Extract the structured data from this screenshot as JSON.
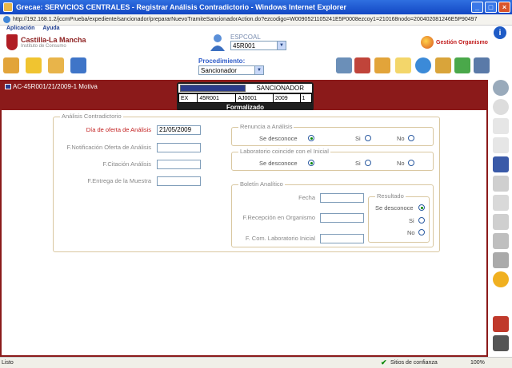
{
  "window": {
    "title": "Grecae: SERVICIOS CENTRALES - Registrar Análisis Contradictorio - Windows Internet Explorer",
    "url": "http://192.168.1.2/jccmPrueba/expediente/sancionador/prepararNuevoTramiteSancionadorAction.do?ezcodigo=W0090521105241E5P0008ezcoy1=210168nodo=200402081246E5P90497"
  },
  "menu": {
    "aplicacion": "Aplicación",
    "ayuda": "Ayuda"
  },
  "header": {
    "logo_name": "Castilla-La Mancha",
    "logo_sub": "Instituto de Consumo",
    "user_label": "ESPCOAL",
    "user_select": "45R001",
    "gestion": "Gestión Organismo",
    "procedimiento_label": "Procedimiento:",
    "procedimiento_value": "Sancionador"
  },
  "record": {
    "motiva": "AC-45R001/21/2009-1 Motiva",
    "sanc_title": "SANCIONADOR",
    "cells": [
      "EX",
      "45R001",
      "AJ0001",
      "2009",
      "1"
    ],
    "state": "Formalizado"
  },
  "form": {
    "main_legend": "Análisis Contradictorio",
    "dia_label": "Día de oferta de Análisis",
    "dia_value": "21/05/2009",
    "notif_label": "F.Notificación Oferta de Análisis",
    "citacion_label": "F.Citación Análisis",
    "entrega_label": "F.Entrega de la Muestra",
    "renuncia_legend": "Renuncia a Análisis",
    "laboratorio_legend": "Laboratorio coincide con el Inicial",
    "opt_desconoce": "Se desconoce",
    "opt_si": "Si",
    "opt_no": "No",
    "boletin_legend": "Boletín Analítico",
    "fecha_label": "Fecha",
    "recepcion_label": "F.Recepción en Organismo",
    "com_label": "F. Com. Laboratorio Inicial",
    "resultado_legend": "Resultado"
  },
  "status": {
    "left": "Listo",
    "zone": "Sitios de confianza",
    "zoom": "100%"
  }
}
